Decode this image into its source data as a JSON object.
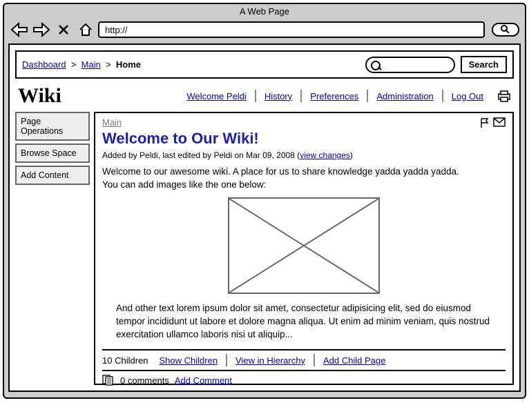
{
  "browser": {
    "title": "A Web Page",
    "url": "http://"
  },
  "breadcrumb": {
    "dashboard": "Dashboard",
    "main": "Main",
    "home": "Home"
  },
  "search_button": "Search",
  "logo": "Wiki",
  "top_nav": {
    "welcome": "Welcome Peldi",
    "history": "History",
    "preferences": "Preferences",
    "administration": "Administration",
    "logout": "Log Out"
  },
  "sidebar": {
    "page_ops": "Page Operations",
    "browse": "Browse Space",
    "add": "Add Content"
  },
  "content": {
    "space": "Main",
    "title": "Welcome to Our Wiki!",
    "byline_prefix": "Added by Peldi, last edited by Peldi on Mar 09, 2008 (",
    "byline_link": "view changes",
    "byline_suffix": ")",
    "intro1": "Welcome to our awesome wiki. A place for us to share knowledge yadda yadda yadda.",
    "intro2": "You can add images like the one below:",
    "lorem": "And other text lorem ipsum dolor sit amet, consectetur adipisicing elit, sed do eiusmod tempor incididunt ut labore et dolore magna aliqua. Ut enim ad minim veniam, quis nostrud exercitation ullamco laboris nisi ut aliquip...",
    "children_count": "10 Children",
    "show_children": "Show Children",
    "view_hierarchy": "View in Hierarchy",
    "add_child": "Add Child Page",
    "comments_count": "0 comments",
    "add_comment": "Add Comment"
  }
}
